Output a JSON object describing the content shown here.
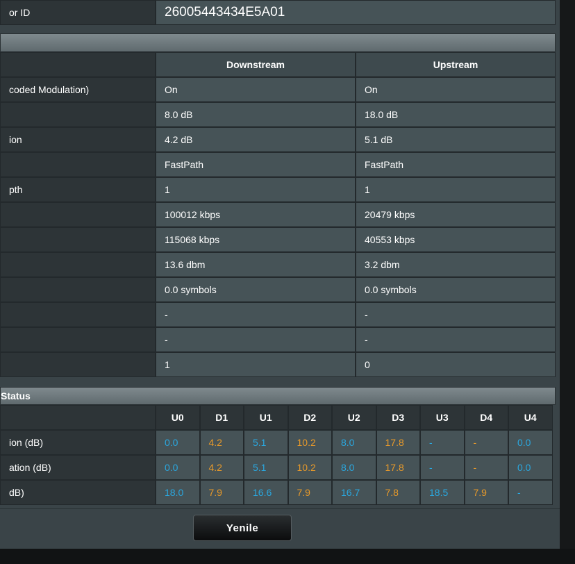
{
  "vendor": {
    "label": "or ID",
    "value": "26005443434E5A01"
  },
  "section1": {
    "title": ""
  },
  "stats": {
    "headers": [
      "",
      "Downstream",
      "Upstream"
    ],
    "rows": [
      {
        "label": "coded Modulation)",
        "down": "On",
        "up": "On"
      },
      {
        "label": "",
        "down": "8.0 dB",
        "up": "18.0 dB"
      },
      {
        "label": "ion",
        "down": "4.2 dB",
        "up": "5.1 dB"
      },
      {
        "label": "",
        "down": "FastPath",
        "up": "FastPath"
      },
      {
        "label": "pth",
        "down": "1",
        "up": "1"
      },
      {
        "label": "",
        "down": "100012 kbps",
        "up": "20479 kbps"
      },
      {
        "label": "",
        "down": "115068 kbps",
        "up": "40553 kbps"
      },
      {
        "label": "",
        "down": "13.6 dbm",
        "up": "3.2 dbm"
      },
      {
        "label": "",
        "down": "0.0 symbols",
        "up": "0.0 symbols"
      },
      {
        "label": "",
        "down": "-",
        "up": "-"
      },
      {
        "label": "",
        "down": "-",
        "up": "-"
      },
      {
        "label": "",
        "down": "1",
        "up": "0"
      }
    ]
  },
  "section2": {
    "title": "Status"
  },
  "snr": {
    "headers": [
      "U0",
      "D1",
      "U1",
      "D2",
      "U2",
      "D3",
      "U3",
      "D4",
      "U4"
    ],
    "rows": [
      {
        "label": "ion (dB)",
        "values": [
          "0.0",
          "4.2",
          "5.1",
          "10.2",
          "8.0",
          "17.8",
          "-",
          "-",
          "0.0"
        ]
      },
      {
        "label": "ation (dB)",
        "values": [
          "0.0",
          "4.2",
          "5.1",
          "10.2",
          "8.0",
          "17.8",
          "-",
          "-",
          "0.0"
        ]
      },
      {
        "label": "dB)",
        "values": [
          "18.0",
          "7.9",
          "16.6",
          "7.9",
          "16.7",
          "7.8",
          "18.5",
          "7.9",
          "-"
        ]
      }
    ],
    "colors": {
      "upstream": "#2aa8e0",
      "downstream": "#e89a2a"
    }
  },
  "actions": {
    "refresh_label": "Yenile"
  }
}
